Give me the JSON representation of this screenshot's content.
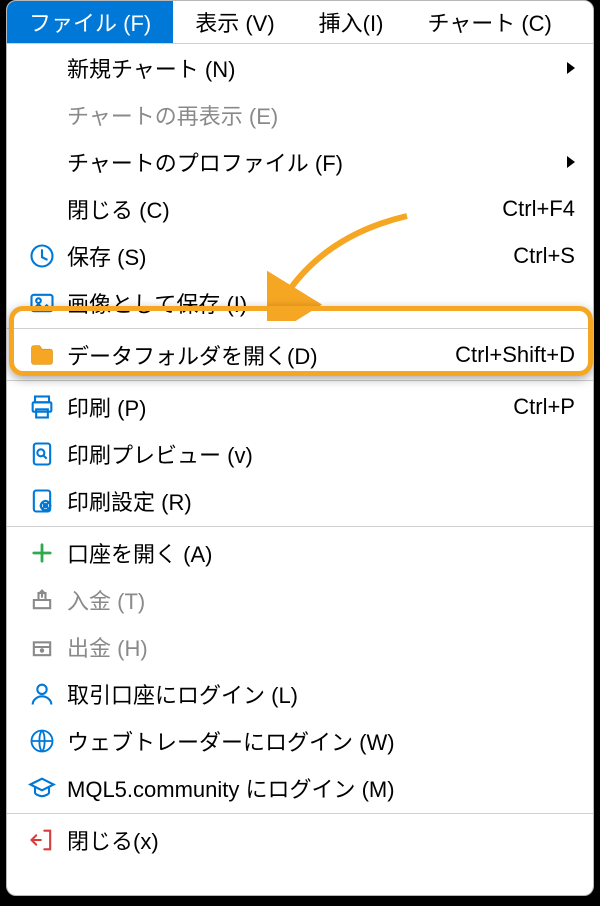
{
  "menubar": {
    "file": "ファイル (F)",
    "view": "表示 (V)",
    "insert": "挿入(I)",
    "chart": "チャート (C)"
  },
  "menu": {
    "new_chart": "新規チャート (N)",
    "reopen_chart": "チャートの再表示 (E)",
    "chart_profile": "チャートのプロファイル (F)",
    "close": "閉じる (C)",
    "close_sc": "Ctrl+F4",
    "save": "保存 (S)",
    "save_sc": "Ctrl+S",
    "save_image": "画像として保存 (I)",
    "open_data": "データフォルダを開く(D)",
    "open_data_sc": "Ctrl+Shift+D",
    "print": "印刷 (P)",
    "print_sc": "Ctrl+P",
    "print_preview": "印刷プレビュー (v)",
    "print_setup": "印刷設定 (R)",
    "open_account": "口座を開く (A)",
    "deposit": "入金 (T)",
    "withdraw": "出金 (H)",
    "login_trade": "取引口座にログイン (L)",
    "login_web": "ウェブトレーダーにログイン (W)",
    "login_mql5": "MQL5.community にログイン (M)",
    "exit": "閉じる(x)"
  }
}
